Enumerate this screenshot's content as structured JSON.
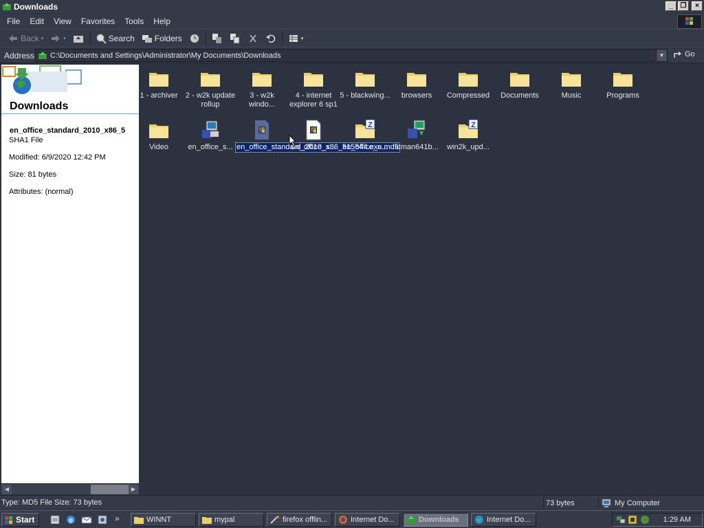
{
  "window": {
    "title": "Downloads"
  },
  "menu": [
    "File",
    "Edit",
    "View",
    "Favorites",
    "Tools",
    "Help"
  ],
  "toolbar": {
    "back": "Back",
    "search": "Search",
    "folders": "Folders"
  },
  "address": {
    "label": "Address",
    "path": "C:\\Documents and Settings\\Administrator\\My Documents\\Downloads",
    "go": "Go"
  },
  "leftpane": {
    "title": "Downloads",
    "filename": "en_office_standard_2010_x86_5",
    "filetype": "SHA1 File",
    "modified": "Modified: 6/9/2020 12:42 PM",
    "size": "Size: 81 bytes",
    "attributes": "Attributes: (normal)"
  },
  "files": [
    {
      "label": "1 - archiver",
      "icon": "folder-icon"
    },
    {
      "label": "2 - w2k update rollup",
      "icon": "folder-icon"
    },
    {
      "label": "3 - w2k windo...",
      "icon": "folder-icon"
    },
    {
      "label": "4 - internet explorer 6 sp1",
      "icon": "folder-icon"
    },
    {
      "label": "5 - blackwing...",
      "icon": "folder-icon"
    },
    {
      "label": "browsers",
      "icon": "folder-icon"
    },
    {
      "label": "Compressed",
      "icon": "folder-icon"
    },
    {
      "label": "Documents",
      "icon": "folder-icon"
    },
    {
      "label": "Music",
      "icon": "folder-icon"
    },
    {
      "label": "Programs",
      "icon": "folder-icon"
    },
    {
      "label": "Video",
      "icon": "folder-icon"
    },
    {
      "label": "en_office_s...",
      "icon": "installer-icon"
    },
    {
      "label": "en_office_standard_2010_x86_515544.exe.md5",
      "icon": "md5-file-icon",
      "selected": true
    },
    {
      "label": "en_office_s...",
      "icon": "sha1-file-icon"
    },
    {
      "label": "en_office_s...",
      "icon": "zip-folder-icon"
    },
    {
      "label": "idman641b...",
      "icon": "setup-icon"
    },
    {
      "label": "win2k_upd...",
      "icon": "zip-folder-icon"
    }
  ],
  "status": {
    "type": "Type: MD5 File Size: 73 bytes",
    "size": "73 bytes",
    "zone": "My Computer"
  },
  "taskbar": {
    "start": "Start",
    "tasks": [
      "WINNT",
      "mypal",
      "firefox offlin...",
      "Internet Do...",
      "Downloads",
      "Internet Do..."
    ],
    "clock": "1:29 AM"
  }
}
